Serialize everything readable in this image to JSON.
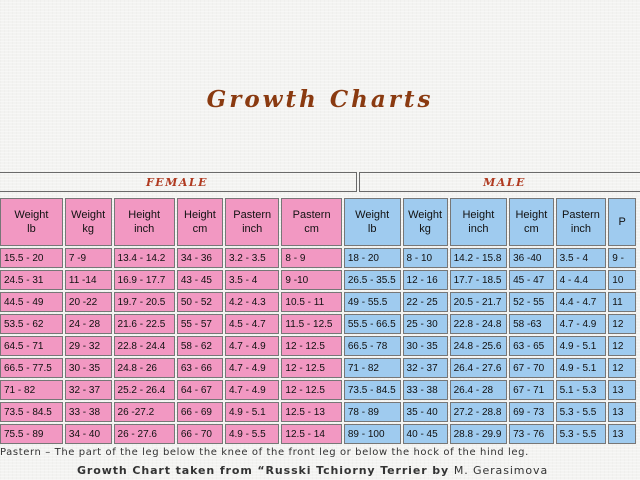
{
  "title": "Growth Charts",
  "groups": {
    "female": "FEMALE",
    "male": "MALE"
  },
  "headers": [
    [
      "Weight",
      "lb"
    ],
    [
      "Weight",
      "kg"
    ],
    [
      "Height",
      "inch"
    ],
    [
      "Height",
      "cm"
    ],
    [
      "Pastern",
      "inch"
    ],
    [
      "Pastern",
      "cm"
    ],
    [
      "Weight",
      "lb"
    ],
    [
      "Weight",
      "kg"
    ],
    [
      "Height",
      "inch"
    ],
    [
      "Height",
      "cm"
    ],
    [
      "Pastern",
      "inch"
    ],
    [
      "P",
      ""
    ]
  ],
  "rows": [
    [
      "15.5 - 20",
      "7 -9",
      "13.4 - 14.2",
      "34 - 36",
      "3.2 - 3.5",
      "8 - 9",
      "18 - 20",
      "8 - 10",
      "14.2 - 15.8",
      "36 -40",
      "3.5 - 4",
      "9 -"
    ],
    [
      "24.5 - 31",
      "11 -14",
      "16.9 - 17.7",
      "43 - 45",
      "3.5 - 4",
      "9 -10",
      "26.5 - 35.5",
      "12 - 16",
      "17.7 - 18.5",
      "45 - 47",
      "4 - 4.4",
      "10"
    ],
    [
      "44.5 - 49",
      "20 -22",
      "19.7 - 20.5",
      "50 - 52",
      "4.2 - 4.3",
      "10.5 - 11",
      "49 - 55.5",
      "22 - 25",
      "20.5 - 21.7",
      "52 - 55",
      "4.4 - 4.7",
      "11"
    ],
    [
      "53.5 - 62",
      "24 - 28",
      "21.6 - 22.5",
      "55 - 57",
      "4.5 - 4.7",
      "11.5 - 12.5",
      "55.5 - 66.5",
      "25 - 30",
      "22.8 - 24.8",
      "58 -63",
      "4.7 - 4.9",
      "12"
    ],
    [
      "64.5 - 71",
      "29 - 32",
      "22.8 - 24.4",
      "58 - 62",
      "4.7 - 4.9",
      "12 - 12.5",
      "66.5 - 78",
      "30 - 35",
      "24.8 - 25.6",
      "63 - 65",
      "4.9 - 5.1",
      "12"
    ],
    [
      "66.5 - 77.5",
      "30 - 35",
      "24.8 - 26",
      "63 - 66",
      "4.7 - 4.9",
      "12 - 12.5",
      "71 - 82",
      "32 - 37",
      "26.4 - 27.6",
      "67 - 70",
      "4.9 - 5.1",
      "12"
    ],
    [
      "71 - 82",
      "32 - 37",
      "25.2 - 26.4",
      "64 - 67",
      "4.7 - 4.9",
      "12 - 12.5",
      "73.5 - 84.5",
      "33 - 38",
      "26.4 - 28",
      "67 - 71",
      "5.1 - 5.3",
      "13"
    ],
    [
      "73.5 - 84.5",
      "33 - 38",
      "26 -27.2",
      "66 - 69",
      "4.9 - 5.1",
      "12.5 - 13",
      "78 - 89",
      "35 - 40",
      "27.2 - 28.8",
      "69 - 73",
      "5.3 - 5.5",
      "13"
    ],
    [
      "75.5 - 89",
      "34 - 40",
      "26 - 27.6",
      "66 - 70",
      "4.9 - 5.5",
      "12.5 - 14",
      "89 - 100",
      "40 - 45",
      "28.8 - 29.9",
      "73 - 76",
      "5.3 - 5.5",
      "13"
    ]
  ],
  "footnote": "Pastern – The part of the leg below the knee of the front leg or below the hock of the hind leg.",
  "credit": {
    "text": "Growth Chart taken from “Russki Tchiorny Terrier by",
    "author": "M. Gerasimova"
  },
  "colors": {
    "female": "#f298c2",
    "male": "#9fcbef",
    "title": "#8a3a10",
    "group_label": "#b03a20"
  }
}
